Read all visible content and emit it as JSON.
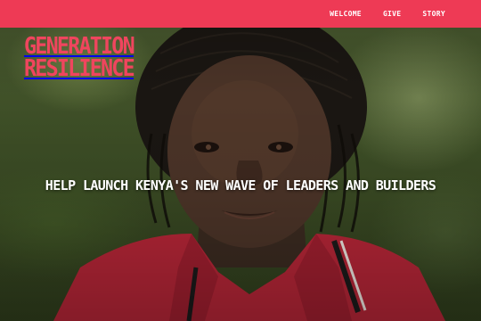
{
  "nav": {
    "items": [
      {
        "label": "WELCOME"
      },
      {
        "label": "GIVE"
      },
      {
        "label": "STORY"
      }
    ]
  },
  "brand": {
    "line1": "GENERATION",
    "line2": "RESILIENCE",
    "accent_color": "#ee3a55"
  },
  "hero": {
    "headline": "HELP LAUNCH KENYA'S NEW WAVE OF LEADERS AND BUILDERS"
  }
}
